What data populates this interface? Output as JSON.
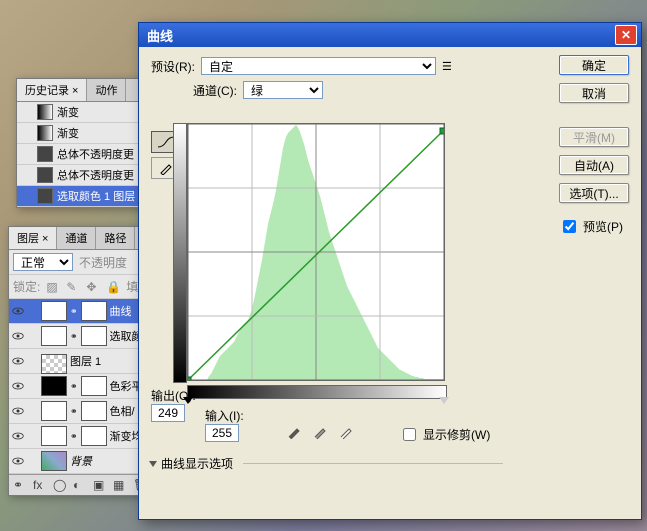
{
  "history_panel": {
    "tabs": [
      "历史记录 ×",
      "动作"
    ],
    "active_tab": 0,
    "items": [
      {
        "label": "渐变",
        "swatch": "grad"
      },
      {
        "label": "渐变",
        "swatch": "grad"
      },
      {
        "label": "总体不透明度更",
        "swatch": "dark"
      },
      {
        "label": "总体不透明度更",
        "swatch": "dark"
      },
      {
        "label": "选取颜色 1 图层",
        "swatch": "dark",
        "selected": true
      }
    ]
  },
  "layers_panel": {
    "tabs": [
      "图层 ×",
      "通道",
      "路径"
    ],
    "active_tab": 0,
    "blend_label": "正常",
    "opacity_label": "不透明度",
    "lock_label": "锁定:",
    "fill_label": "填充",
    "layers": [
      {
        "name": "曲线",
        "thumb": "white",
        "mask": true,
        "selected": true,
        "linked": true
      },
      {
        "name": "选取颜",
        "thumb": "white",
        "mask": true,
        "linked": true
      },
      {
        "name": "图层 1",
        "thumb": "chk"
      },
      {
        "name": "色彩平",
        "thumb": "blk",
        "mask": true,
        "linked": true
      },
      {
        "name": "色相/",
        "thumb": "white",
        "mask": true,
        "linked": true
      },
      {
        "name": "渐变均",
        "thumb": "white",
        "mask": true,
        "linked": true
      },
      {
        "name": "背景",
        "thumb": "img",
        "italic": true,
        "locked": true
      }
    ]
  },
  "curves_dialog": {
    "title": "曲线",
    "preset_label": "预设(R):",
    "preset_value": "自定",
    "channel_label": "通道(C):",
    "channel_value": "绿",
    "output_label": "输出(O):",
    "output_value": "249",
    "input_label": "输入(I):",
    "input_value": "255",
    "show_clipping_label": "显示修剪(W)",
    "show_clipping_checked": false,
    "curve_options_label": "曲线显示选项",
    "buttons": {
      "ok": "确定",
      "cancel": "取消",
      "smooth": "平滑(M)",
      "auto": "自动(A)",
      "options": "选项(T)..."
    },
    "preview_label": "预览(P)",
    "preview_checked": true,
    "eyedroppers": [
      "black-point",
      "gray-point",
      "white-point"
    ],
    "curve_tools": [
      "curve-point-tool",
      "pencil-tool"
    ]
  },
  "chart_data": {
    "type": "line",
    "title": "",
    "xlabel": "输入",
    "ylabel": "输出",
    "xlim": [
      0,
      255
    ],
    "ylim": [
      0,
      255
    ],
    "curve_points": [
      {
        "x": 0,
        "y": 0
      },
      {
        "x": 255,
        "y": 249
      }
    ],
    "histogram_channel": "green",
    "histogram": [
      0,
      0,
      0,
      0,
      0,
      0,
      0,
      0,
      0,
      0,
      0,
      0,
      0,
      0,
      0,
      0,
      0,
      0,
      0,
      0,
      2,
      4,
      5,
      6,
      8,
      10,
      12,
      14,
      16,
      18,
      20,
      22,
      24,
      25,
      26,
      27,
      28,
      29,
      30,
      31,
      32,
      33,
      34,
      35,
      36,
      37,
      38,
      40,
      42,
      44,
      46,
      48,
      50,
      52,
      54,
      55,
      56,
      57,
      58,
      59,
      60,
      62,
      65,
      68,
      72,
      76,
      80,
      85,
      90,
      95,
      100,
      105,
      110,
      115,
      120,
      126,
      132,
      138,
      144,
      150,
      156,
      160,
      164,
      168,
      172,
      176,
      180,
      185,
      190,
      196,
      202,
      208,
      214,
      220,
      226,
      232,
      236,
      240,
      243,
      245,
      247,
      248,
      249,
      250,
      251,
      252,
      253,
      254,
      255,
      254,
      252,
      250,
      248,
      245,
      242,
      239,
      236,
      232,
      228,
      224,
      220,
      217,
      214,
      211,
      208,
      205,
      202,
      199,
      196,
      193,
      190,
      187,
      184,
      180,
      176,
      172,
      168,
      164,
      160,
      156,
      152,
      148,
      145,
      142,
      139,
      136,
      133,
      130,
      127,
      124,
      121,
      118,
      115,
      112,
      109,
      106,
      103,
      100,
      97,
      94,
      92,
      90,
      88,
      86,
      84,
      82,
      80,
      78,
      76,
      74,
      72,
      70,
      68,
      66,
      64,
      62,
      60,
      58,
      56,
      54,
      52,
      50,
      48,
      46,
      44,
      42,
      40,
      38,
      36,
      34,
      32,
      31,
      30,
      29,
      28,
      27,
      26,
      25,
      24,
      23,
      22,
      21,
      20,
      19,
      18,
      17,
      16,
      15,
      14,
      13,
      12,
      11,
      10,
      10,
      9,
      9,
      8,
      8,
      7,
      7,
      6,
      6,
      5,
      5,
      4,
      4,
      4,
      3,
      3,
      3,
      3,
      2,
      2,
      2,
      2,
      2,
      1,
      1,
      1,
      1,
      1,
      1,
      1,
      1,
      1,
      1,
      1,
      1,
      1,
      1,
      1,
      1,
      1,
      1,
      1,
      1
    ]
  }
}
